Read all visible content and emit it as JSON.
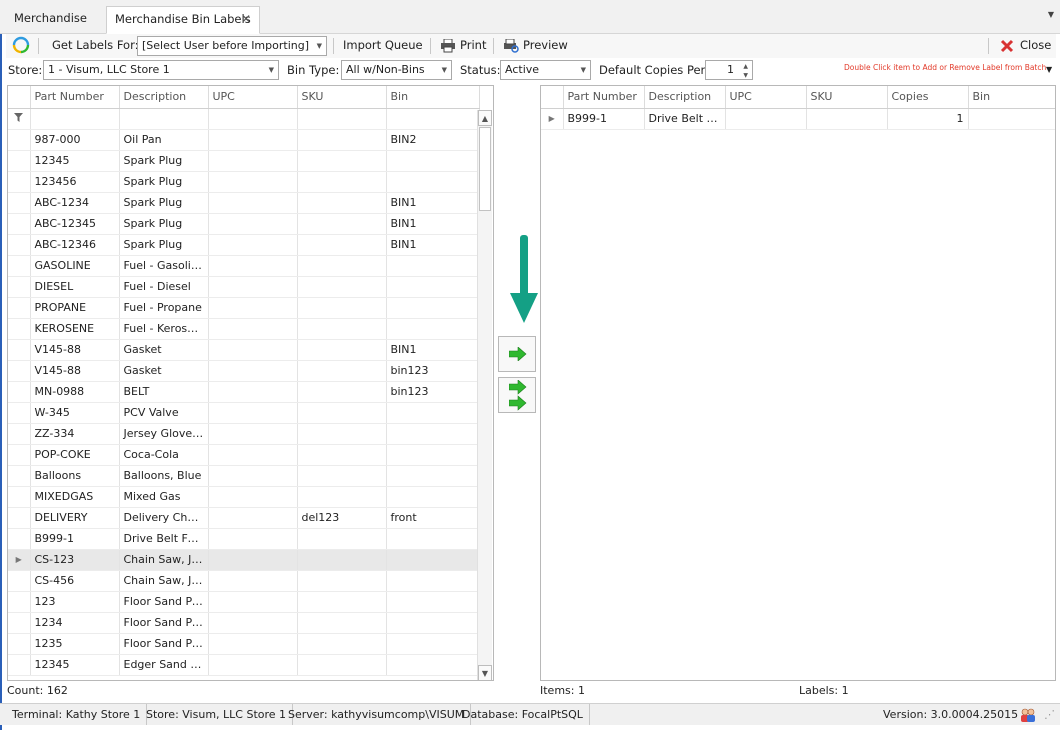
{
  "tabs": [
    {
      "label": "Merchandise"
    },
    {
      "label": "Merchandise Bin Labels"
    }
  ],
  "toolbar": {
    "get_labels_label": "Get Labels For:",
    "user_select": "[Select User before Importing]",
    "import_queue": "Import Queue",
    "print": "Print",
    "preview": "Preview",
    "close": "Close"
  },
  "filters": {
    "store_label": "Store:",
    "store_value": "1 - Visum, LLC Store 1",
    "bin_type_label": "Bin Type:",
    "bin_type_value": "All w/Non-Bins",
    "status_label": "Status:",
    "status_value": "Active",
    "default_copies_label": "Default Copies Per:",
    "default_copies_value": "1",
    "hint": "Double Click item to Add or Remove Label from Batch"
  },
  "left_grid": {
    "columns": [
      "Part Number",
      "Description",
      "UPC",
      "SKU",
      "Bin"
    ],
    "rows": [
      [
        "987-000",
        "Oil Pan",
        "",
        "",
        "BIN2"
      ],
      [
        "12345",
        "Spark Plug",
        "",
        "",
        ""
      ],
      [
        "123456",
        "Spark Plug",
        "",
        "",
        ""
      ],
      [
        "ABC-1234",
        "Spark Plug",
        "",
        "",
        "BIN1"
      ],
      [
        "ABC-12345",
        "Spark Plug",
        "",
        "",
        "BIN1"
      ],
      [
        "ABC-12346",
        "Spark Plug",
        "",
        "",
        "BIN1"
      ],
      [
        "GASOLINE",
        "Fuel - Gasoline",
        "",
        "",
        ""
      ],
      [
        "DIESEL",
        "Fuel - Diesel",
        "",
        "",
        ""
      ],
      [
        "PROPANE",
        "Fuel - Propane",
        "",
        "",
        ""
      ],
      [
        "KEROSENE",
        "Fuel - Kerosene",
        "",
        "",
        ""
      ],
      [
        "V145-88",
        "Gasket",
        "",
        "",
        "BIN1"
      ],
      [
        "V145-88",
        "Gasket",
        "",
        "",
        "bin123"
      ],
      [
        "MN-0988",
        "BELT",
        "",
        "",
        "bin123"
      ],
      [
        "W-345",
        "PCV Valve",
        "",
        "",
        ""
      ],
      [
        "ZZ-334",
        "Jersey Gloves,...",
        "",
        "",
        ""
      ],
      [
        "POP-COKE",
        "Coca-Cola",
        "",
        "",
        ""
      ],
      [
        "Balloons",
        "Balloons, Blue",
        "",
        "",
        ""
      ],
      [
        "MIXEDGAS",
        "Mixed Gas",
        "",
        "",
        ""
      ],
      [
        "DELIVERY",
        "Delivery Charge",
        "",
        "del123",
        "front"
      ],
      [
        "B999-1",
        "Drive Belt For ...",
        "",
        "",
        ""
      ],
      [
        "CS-123",
        "Chain Saw, JD...",
        "",
        "",
        ""
      ],
      [
        "CS-456",
        "Chain Saw, JD...",
        "",
        "",
        ""
      ],
      [
        "123",
        "Floor Sand Pap...",
        "",
        "",
        ""
      ],
      [
        "1234",
        "Floor Sand Pap...",
        "",
        "",
        ""
      ],
      [
        "1235",
        "Floor Sand Pap...",
        "",
        "",
        ""
      ],
      [
        "12345",
        "Edger Sand Pa...",
        "",
        "",
        ""
      ]
    ],
    "count": "Count: 162"
  },
  "right_grid": {
    "columns": [
      "Part Number",
      "Description",
      "UPC",
      "SKU",
      "Copies",
      "Bin"
    ],
    "rows": [
      [
        "B999-1",
        "Drive Belt Fo...",
        "",
        "",
        "1",
        ""
      ]
    ],
    "items": "Items: 1",
    "labels": "Labels: 1"
  },
  "statusbar": {
    "terminal": "Terminal: Kathy Store 1",
    "store": "Store: Visum, LLC Store 1",
    "server": "Server: kathyvisumcomp\\VISUM",
    "database": "Database: FocalPtSQL",
    "version": "Version: 3.0.0004.25015"
  },
  "colors": {
    "accent_blue": "#2a5fb8",
    "arrow_teal": "#14a085",
    "move_green": "#2fb82f",
    "hint_red": "#e23a2a",
    "close_red": "#d83232"
  },
  "icons": {
    "refresh": "refresh-icon",
    "print": "printer-icon",
    "preview": "preview-icon",
    "close": "close-x-icon",
    "filter": "filter-icon",
    "add_one": "arrow-right-icon",
    "add_all": "double-arrow-right-icon",
    "users": "users-icon"
  }
}
